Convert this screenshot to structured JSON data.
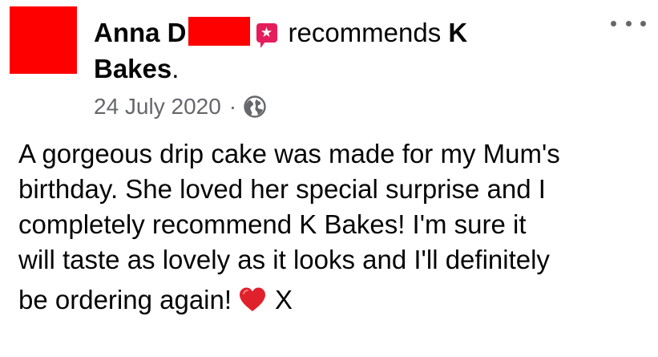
{
  "post": {
    "author_first": "Anna D",
    "recommend_icon": "recommend-star-icon",
    "recommend_glyph": "★",
    "verb": "recommends",
    "page_name_line1": "K",
    "page_name_line2": "Bakes",
    "period": ".",
    "date": "24 July 2020",
    "separator": "·",
    "privacy_icon": "globe-icon",
    "more_icon": "more-options-icon",
    "body_lines": [
      "A gorgeous drip cake was made for my Mum's",
      "birthday. She loved her special surprise and I",
      "completely recommend K Bakes! I'm sure it",
      "will taste as lovely as it looks and I'll definitely",
      "be ordering again!"
    ],
    "emoji_icon": "red-heart-icon",
    "sign_off": "X"
  },
  "colors": {
    "redaction": "#ff0000",
    "recommend_badge": "#e41e5c",
    "secondary_text": "#65676b",
    "primary_text": "#050505"
  }
}
